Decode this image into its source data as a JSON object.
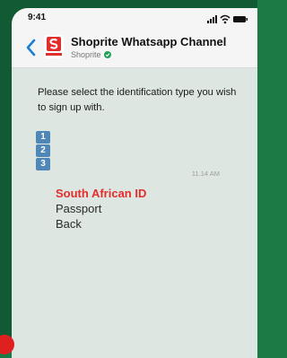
{
  "status_bar": {
    "time": "9:41"
  },
  "header": {
    "title": "Shoprite Whatsapp Channel",
    "subtitle": "Shoprite",
    "logo_text": "Shoprite"
  },
  "message": {
    "prompt": "Please select the identification type you wish to sign up with.",
    "keycaps": [
      "1",
      "2",
      "3"
    ],
    "time": "11.14 AM"
  },
  "options": [
    {
      "label": "South African ID",
      "selected": true
    },
    {
      "label": "Passport",
      "selected": false
    },
    {
      "label": "Back",
      "selected": false
    }
  ],
  "colors": {
    "background_green": "#1c7a45",
    "accent_blue": "#1a7fd6",
    "brand_red": "#e22d2d",
    "keycap_blue": "#4f88b6",
    "chat_background": "#dde6e0"
  }
}
